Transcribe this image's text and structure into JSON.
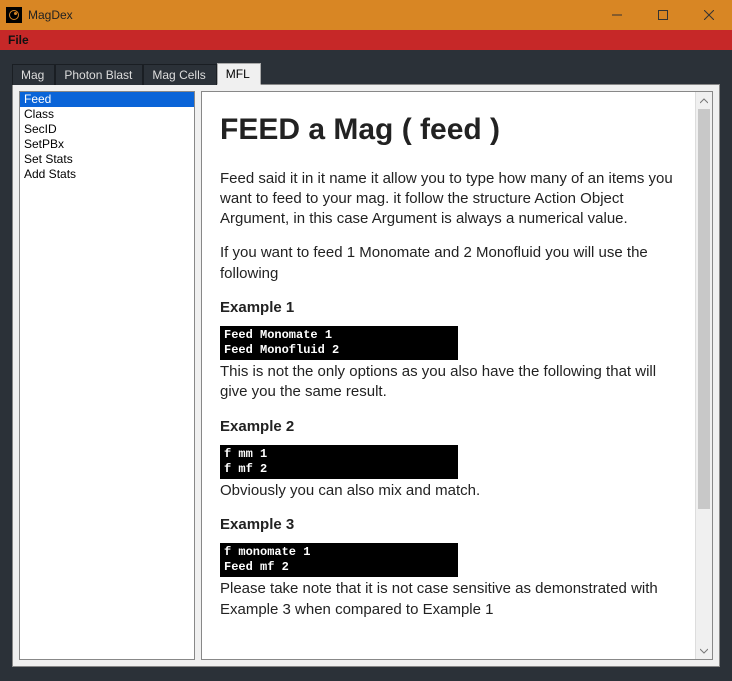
{
  "window": {
    "title": "MagDex",
    "controls": {
      "minimize": "–",
      "maximize": "▭",
      "close": "✕"
    }
  },
  "menubar": {
    "file": "File"
  },
  "tabs": [
    {
      "label": "Mag"
    },
    {
      "label": "Photon Blast"
    },
    {
      "label": "Mag Cells"
    },
    {
      "label": "MFL",
      "active": true
    }
  ],
  "sidebar": {
    "items": [
      "Feed",
      "Class",
      "SecID",
      "SetPBx",
      "Set Stats",
      "Add Stats"
    ],
    "selected": 0
  },
  "doc": {
    "h1": "FEED a Mag ( feed )",
    "p1": "Feed said it in it name it allow you to type how many of an items you want to feed to your mag. it follow the structure Action Object Argument, in this case Argument is always a numerical value.",
    "p2": "If you want to feed 1 Monomate and 2 Monofluid you will use the following",
    "ex1_h": "Example 1",
    "ex1_code": "Feed Monomate 1\nFeed Monofluid 2",
    "ex1_after": "This is not the only options as you also have the following that will give you the same result.",
    "ex2_h": "Example 2",
    "ex2_code": "f mm 1\nf mf 2",
    "ex2_after": "Obviously you can also mix and match.",
    "ex3_h": "Example 3",
    "ex3_code": "f monomate 1\nFeed mf 2",
    "ex3_after": "Please take note that it is not case sensitive as demonstrated with Example 3 when compared to Example 1"
  }
}
